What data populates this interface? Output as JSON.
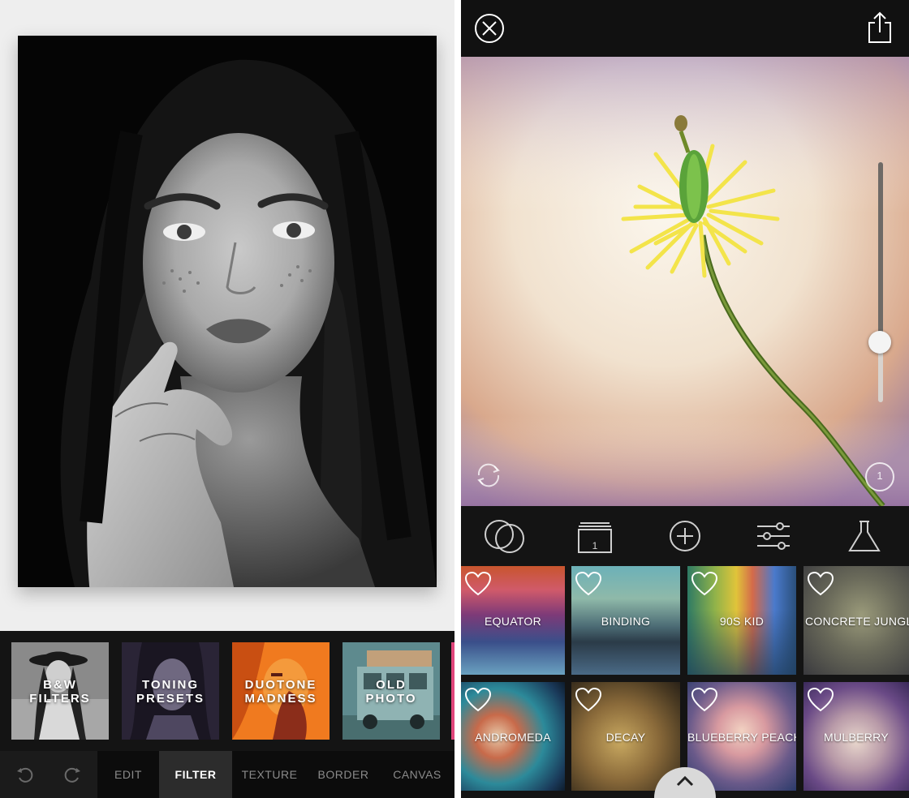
{
  "left_app": {
    "filters": [
      {
        "line1": "B&W",
        "line2": "FILTERS"
      },
      {
        "line1": "TONING",
        "line2": "PRESETS"
      },
      {
        "line1": "DUOTONE",
        "line2": "MADNESS"
      },
      {
        "line1": "OLD",
        "line2": "PHOTO"
      }
    ],
    "tabs": [
      {
        "label": "EDIT"
      },
      {
        "label": "FILTER"
      },
      {
        "label": "TEXTURE"
      },
      {
        "label": "BORDER"
      },
      {
        "label": "CANVAS"
      }
    ],
    "active_tab": "FILTER",
    "icons": {
      "undo": "undo-icon",
      "redo": "redo-icon"
    }
  },
  "right_app": {
    "icons": {
      "close": "close-circle-icon",
      "share": "share-icon",
      "reset": "rotate-reset-icon",
      "info": "info-circle-icon",
      "blend": "blend-circles-icon",
      "layers": "layers-icon",
      "add": "add-circle-icon",
      "adjust": "sliders-icon",
      "lab": "flask-icon",
      "drawer": "chevron-up-icon"
    },
    "layer_number": "1",
    "info_number": "1",
    "opacity_slider": 0.25,
    "textures": [
      {
        "name": "EQUATOR"
      },
      {
        "name": "BINDING"
      },
      {
        "name": "90S KID"
      },
      {
        "name": "CONCRETE JUNGLE"
      },
      {
        "name": "ANDROMEDA"
      },
      {
        "name": "DECAY"
      },
      {
        "name": "BLUEBERRY PEACH"
      },
      {
        "name": "MULBERRY"
      }
    ],
    "selected_texture": "MULBERRY"
  }
}
